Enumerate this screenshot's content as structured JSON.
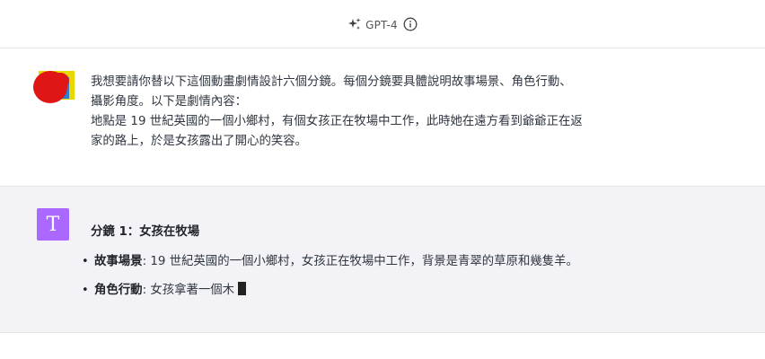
{
  "header": {
    "model_name": "GPT-4"
  },
  "user_message": {
    "lines": [
      "我想要請你替以下這個動畫劇情設計六個分鏡。每個分鏡要具體說明故事場景、角色行動、",
      "攝影角度。以下是劇情內容：",
      "地點是 19 世紀英國的一個小鄉村，有個女孩正在牧場中工作，此時她在遠方看到爺爺正在返",
      "家的路上，於是女孩露出了開心的笑容。"
    ]
  },
  "assistant_message": {
    "avatar_letter": "T",
    "heading": "分鏡 1：女孩在牧場",
    "bullets": [
      {
        "key": "故事場景",
        "sep": ": ",
        "text": "19 世紀英國的一個小鄉村，女孩正在牧場中工作，背景是青翠的草原和幾隻羊。"
      },
      {
        "key": "角色行動",
        "sep": ": ",
        "text": "女孩拿著一個木"
      }
    ]
  },
  "colors": {
    "assistant_avatar_bg": "#ab68ff",
    "assistant_row_bg": "#f3f3f7",
    "text": "#2f3640"
  }
}
